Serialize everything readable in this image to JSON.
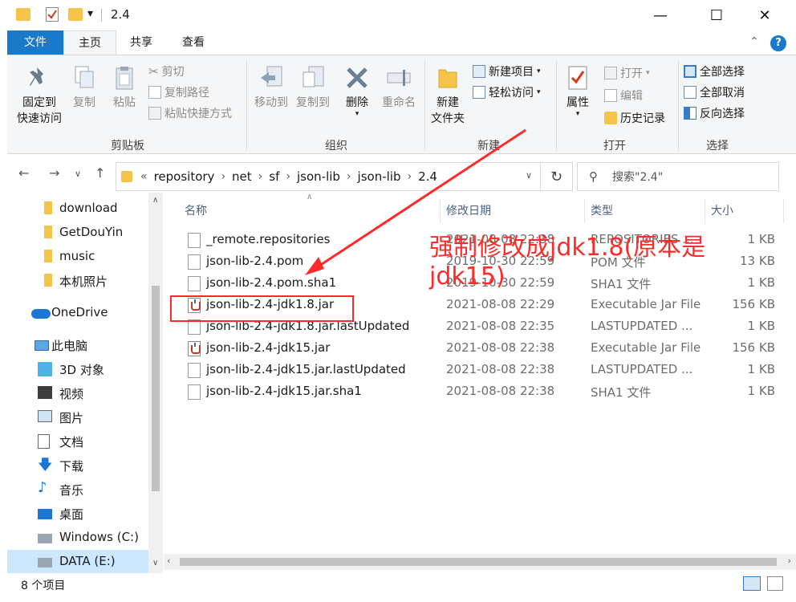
{
  "titlebar": {
    "title": "2.4",
    "quick_access_dropdown": "▾",
    "minimize": "—",
    "maximize": "☐",
    "close": "✕"
  },
  "ribbon_tabs": [
    "文件",
    "主页",
    "共享",
    "查看"
  ],
  "ribbon": {
    "clipboard": {
      "pin_label_1": "固定到",
      "pin_label_2": "快速访问",
      "copy": "复制",
      "paste": "粘贴",
      "cut": "剪切",
      "copy_path": "复制路径",
      "paste_shortcut": "粘贴快捷方式",
      "group": "剪贴板"
    },
    "organize": {
      "move_to": "移动到",
      "copy_to": "复制到",
      "delete": "删除",
      "rename": "重命名",
      "group": "组织"
    },
    "new": {
      "new_folder_1": "新建",
      "new_folder_2": "文件夹",
      "new_item": "新建项目",
      "easy_access": "轻松访问",
      "group": "新建"
    },
    "open": {
      "properties": "属性",
      "open": "打开",
      "edit": "编辑",
      "history": "历史记录",
      "group": "打开"
    },
    "select": {
      "select_all": "全部选择",
      "select_none": "全部取消",
      "invert": "反向选择",
      "group": "选择"
    }
  },
  "address": {
    "overflow": "«",
    "crumbs": [
      "repository",
      "net",
      "sf",
      "json-lib",
      "json-lib",
      "2.4"
    ],
    "search_placeholder": "搜索\"2.4\""
  },
  "nav_pane": {
    "items": [
      "download",
      "GetDouYin",
      "music",
      "本机照片",
      "OneDrive",
      "此电脑",
      "3D 对象",
      "视频",
      "图片",
      "文档",
      "下载",
      "音乐",
      "桌面",
      "Windows (C:)",
      "DATA (E:)"
    ]
  },
  "columns": {
    "name": "名称",
    "date": "修改日期",
    "type": "类型",
    "size": "大小"
  },
  "files": [
    {
      "name": "_remote.repositories",
      "date": "2021-08-08 22:38",
      "type": "REPOSITORIES ...",
      "size": "1 KB"
    },
    {
      "name": "json-lib-2.4.pom",
      "date": "2019-10-30 22:59",
      "type": "POM 文件",
      "size": "13 KB"
    },
    {
      "name": "json-lib-2.4.pom.sha1",
      "date": "2019-10-30 22:59",
      "type": "SHA1 文件",
      "size": "1 KB"
    },
    {
      "name": "json-lib-2.4-jdk1.8.jar",
      "date": "2021-08-08 22:29",
      "type": "Executable Jar File",
      "size": "156 KB"
    },
    {
      "name": "json-lib-2.4-jdk1.8.jar.lastUpdated",
      "date": "2021-08-08 22:35",
      "type": "LASTUPDATED ...",
      "size": "1 KB"
    },
    {
      "name": "json-lib-2.4-jdk15.jar",
      "date": "2021-08-08 22:38",
      "type": "Executable Jar File",
      "size": "156 KB"
    },
    {
      "name": "json-lib-2.4-jdk15.jar.lastUpdated",
      "date": "2021-08-08 22:38",
      "type": "LASTUPDATED ...",
      "size": "1 KB"
    },
    {
      "name": "json-lib-2.4-jdk15.jar.sha1",
      "date": "2021-08-08 22:38",
      "type": "SHA1 文件",
      "size": "1 KB"
    }
  ],
  "annotation": "强制修改成jdk1.8(原本是jdk15)",
  "status": {
    "count": "8 个项目"
  },
  "colors": {
    "accent": "#1979ca",
    "annotation_red": "#ff2a2a",
    "selected_bg": "#cce8ff"
  }
}
